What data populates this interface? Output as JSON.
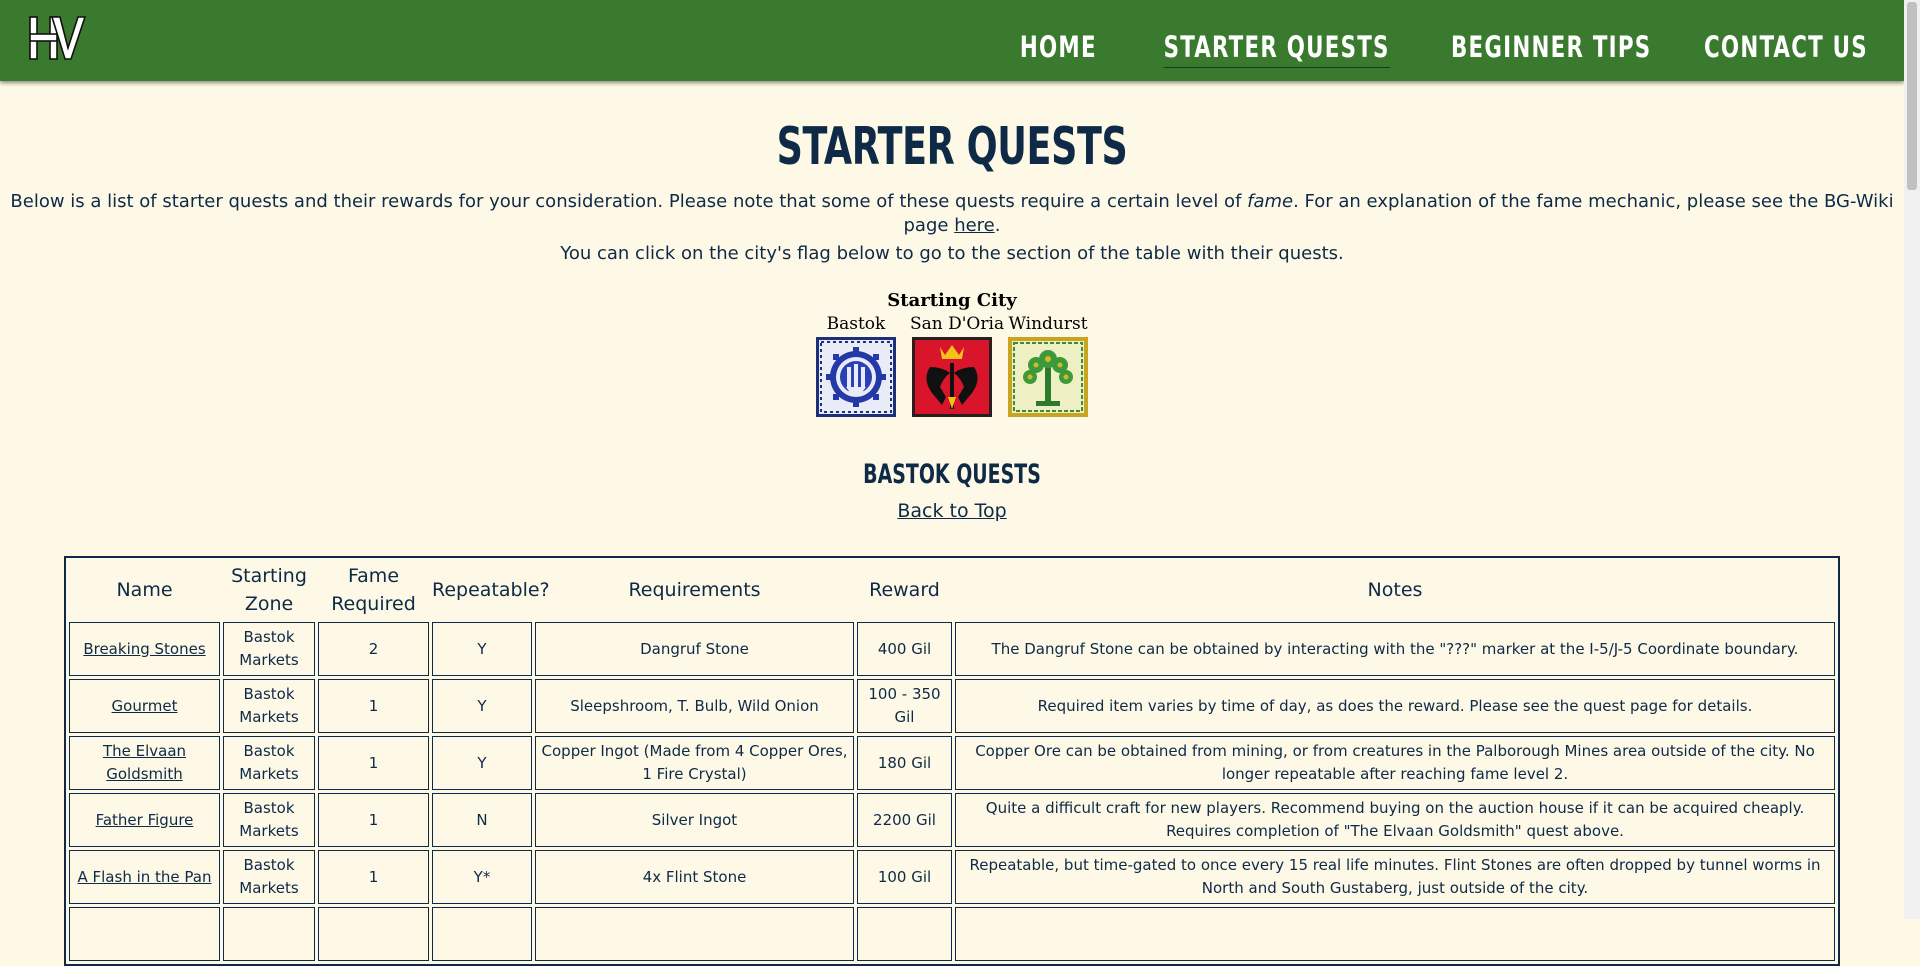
{
  "header": {
    "logo_text": "HV",
    "nav": [
      {
        "label": "HOME"
      },
      {
        "label": "STARTER QUESTS"
      },
      {
        "label": "BEGINNER TIPS"
      },
      {
        "label": "CONTACT US"
      }
    ],
    "colors": {
      "bar": "#3a7a2e",
      "text": "#ffffff"
    }
  },
  "page": {
    "title": "STARTER QUESTS",
    "intro": {
      "before_fame": "Below is a list of starter quests and their rewards for your consideration. Please note that some of these quests require a certain level of ",
      "fame_word": "fame",
      "after_fame": ". For an explanation of the fame mechanic, please see the BG-Wiki page ",
      "link_text": "here",
      "end": "."
    },
    "flag_hint": "You can click on the city's flag below to go to the section of the table with their quests.",
    "colors": {
      "background": "#fdf9e6",
      "text": "#0e2a47"
    }
  },
  "starting_city": {
    "caption": "Starting City",
    "cities": [
      {
        "name": "Bastok",
        "flag_icon": "bastok-flag-icon"
      },
      {
        "name": "San D'Oria",
        "flag_icon": "sandoria-flag-icon"
      },
      {
        "name": "Windurst",
        "flag_icon": "windurst-flag-icon"
      }
    ]
  },
  "section": {
    "title": "BASTOK QUESTS",
    "back_to_top": "Back to Top"
  },
  "table": {
    "headers": {
      "name": "Name",
      "zone": "Starting Zone",
      "fame": "Fame Required",
      "repeatable": "Repeatable?",
      "requirements": "Requirements",
      "reward": "Reward",
      "notes": "Notes"
    },
    "rows": [
      {
        "name": "Breaking Stones",
        "zone": "Bastok Markets",
        "fame": "2",
        "repeatable": "Y",
        "requirements": "Dangruf Stone",
        "reward": "400 Gil",
        "notes": "The Dangruf Stone can be obtained by interacting with the \"???\" marker at the I-5/J-5 Coordinate boundary."
      },
      {
        "name": "Gourmet",
        "zone": "Bastok Markets",
        "fame": "1",
        "repeatable": "Y",
        "requirements": "Sleepshroom, T. Bulb, Wild Onion",
        "reward": "100 - 350 Gil",
        "notes": "Required item varies by time of day, as does the reward. Please see the quest page for details."
      },
      {
        "name": "The Elvaan Goldsmith",
        "zone": "Bastok Markets",
        "fame": "1",
        "repeatable": "Y",
        "requirements": "Copper Ingot (Made from 4 Copper Ores, 1 Fire Crystal)",
        "reward": "180 Gil",
        "notes": "Copper Ore can be obtained from mining, or from creatures in the Palborough Mines area outside of the city. No longer repeatable after reaching fame level 2."
      },
      {
        "name": "Father Figure",
        "zone": "Bastok Markets",
        "fame": "1",
        "repeatable": "N",
        "requirements": "Silver Ingot",
        "reward": "2200 Gil",
        "notes": "Quite a difficult craft for new players. Recommend buying on the auction house if it can be acquired cheaply. Requires completion of \"The Elvaan Goldsmith\" quest above."
      },
      {
        "name": "A Flash in the Pan",
        "zone": "Bastok Markets",
        "fame": "1",
        "repeatable": "Y*",
        "requirements": "4x Flint Stone",
        "reward": "100 Gil",
        "notes": "Repeatable, but time-gated to once every 15 real life minutes. Flint Stones are often dropped by tunnel worms in North and South Gustaberg, just outside of the city."
      },
      {
        "name": "",
        "zone": "",
        "fame": "",
        "repeatable": "",
        "requirements": "",
        "reward": "",
        "notes": ""
      }
    ]
  }
}
